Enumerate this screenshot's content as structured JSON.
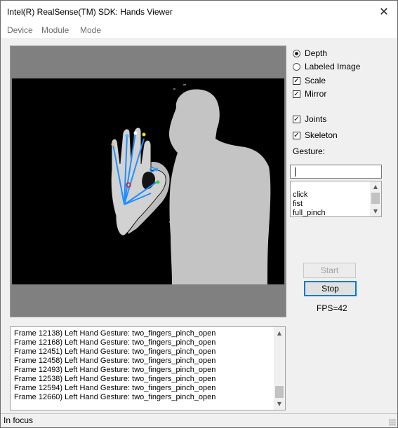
{
  "window": {
    "title": "Intel(R) RealSense(TM) SDK: Hands Viewer"
  },
  "menu": {
    "items": [
      "Device",
      "Module",
      "Mode"
    ]
  },
  "options": {
    "depth": {
      "label": "Depth",
      "selected": true
    },
    "labeled_image": {
      "label": "Labeled Image",
      "selected": false
    },
    "scale": {
      "label": "Scale",
      "checked": true
    },
    "mirror": {
      "label": "Mirror",
      "checked": true
    },
    "joints": {
      "label": "Joints",
      "checked": true
    },
    "skeleton": {
      "label": "Skeleton",
      "checked": true
    }
  },
  "gesture": {
    "label": "Gesture:",
    "input_value": "",
    "list": [
      "click",
      "fist",
      "full_pinch"
    ]
  },
  "buttons": {
    "start": {
      "label": "Start",
      "enabled": false
    },
    "stop": {
      "label": "Stop",
      "enabled": true
    }
  },
  "fps": "FPS=42",
  "log": [
    "Frame 12138)  Left Hand Gesture: two_fingers_pinch_open",
    "Frame 12168)  Left Hand Gesture: two_fingers_pinch_open",
    "Frame 12451)  Left Hand Gesture: two_fingers_pinch_open",
    "Frame 12458)  Left Hand Gesture: two_fingers_pinch_open",
    "Frame 12493)  Left Hand Gesture: two_fingers_pinch_open",
    "Frame 12538)  Left Hand Gesture: two_fingers_pinch_open",
    "Frame 12594)  Left Hand Gesture: two_fingers_pinch_open",
    "Frame 12660)  Left Hand Gesture: two_fingers_pinch_open"
  ],
  "status": "In focus",
  "icons": {
    "close": "close-icon",
    "check": "checkmark-icon",
    "scroll_up": "arrow-up-icon",
    "scroll_down": "arrow-down-icon"
  },
  "colors": {
    "skeleton": "#1e90ff",
    "contour": "#000000",
    "joint_highlight": "#d02020"
  }
}
